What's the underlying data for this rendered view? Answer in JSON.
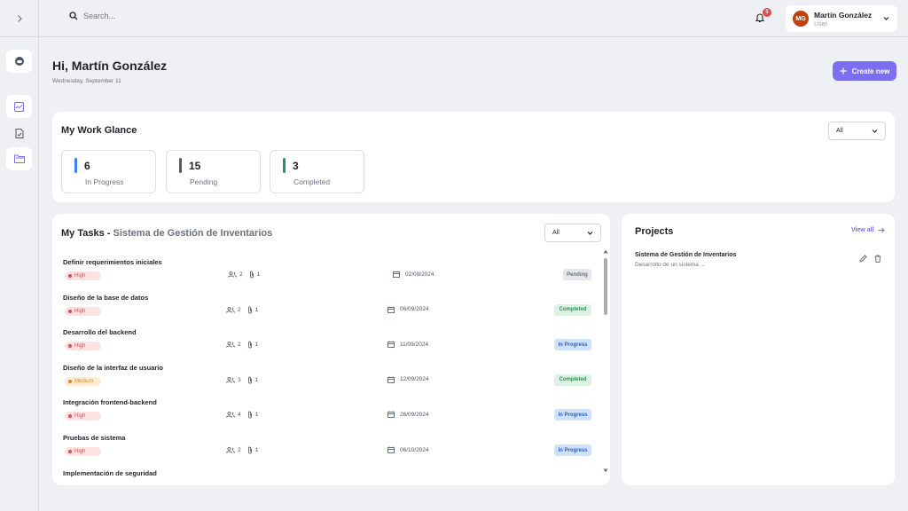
{
  "colors": {
    "accent": "#7c6ef0",
    "in_progress": "#3b82f6",
    "pending": "#555b63",
    "completed": "#2f8f6f",
    "high": "#e5484d",
    "medium": "#f0a050"
  },
  "search": {
    "placeholder": "Search..."
  },
  "notifications": {
    "count": "5"
  },
  "user": {
    "initials": "MG",
    "name": "Martín González",
    "role": "User"
  },
  "greeting": {
    "title": "Hi, Martín González",
    "date": "Wednesday, September 11"
  },
  "create_button": {
    "label": "Create new"
  },
  "glance": {
    "title": "My Work Glance",
    "filter": "All",
    "stats": [
      {
        "value": "6",
        "label": "In Progress"
      },
      {
        "value": "15",
        "label": "Pending"
      },
      {
        "value": "3",
        "label": "Completed"
      }
    ]
  },
  "tasks": {
    "title": "My Tasks",
    "separator": " - ",
    "project": "Sistema de Gestión de Inventarios",
    "filter": "All",
    "rows": [
      {
        "name": "Definir requerimientos iniciales",
        "priority": "High",
        "members": "2",
        "attachments": "1",
        "due": "02/09/2024",
        "status": "Pending"
      },
      {
        "name": "Diseño de la base de datos",
        "priority": "High",
        "members": "2",
        "attachments": "1",
        "due": "06/09/2024",
        "status": "Completed"
      },
      {
        "name": "Desarrollo del backend",
        "priority": "High",
        "members": "2",
        "attachments": "1",
        "due": "11/09/2024",
        "status": "In Progress"
      },
      {
        "name": "Diseño de la interfaz de usuario",
        "priority": "Medium",
        "members": "3",
        "attachments": "1",
        "due": "12/09/2024",
        "status": "Completed"
      },
      {
        "name": "Integración frontend-backend",
        "priority": "High",
        "members": "4",
        "attachments": "1",
        "due": "26/09/2024",
        "status": "In Progress"
      },
      {
        "name": "Pruebas de sistema",
        "priority": "High",
        "members": "2",
        "attachments": "1",
        "due": "06/10/2024",
        "status": "In Progress"
      },
      {
        "name": "Implementación de seguridad",
        "priority": "",
        "members": "",
        "attachments": "",
        "due": "",
        "status": ""
      }
    ]
  },
  "projects": {
    "title": "Projects",
    "view_all": "View all",
    "items": [
      {
        "name": "Sistema de Gestión de Inventarios",
        "description": "Desarrollo de un sistema ..."
      }
    ]
  }
}
